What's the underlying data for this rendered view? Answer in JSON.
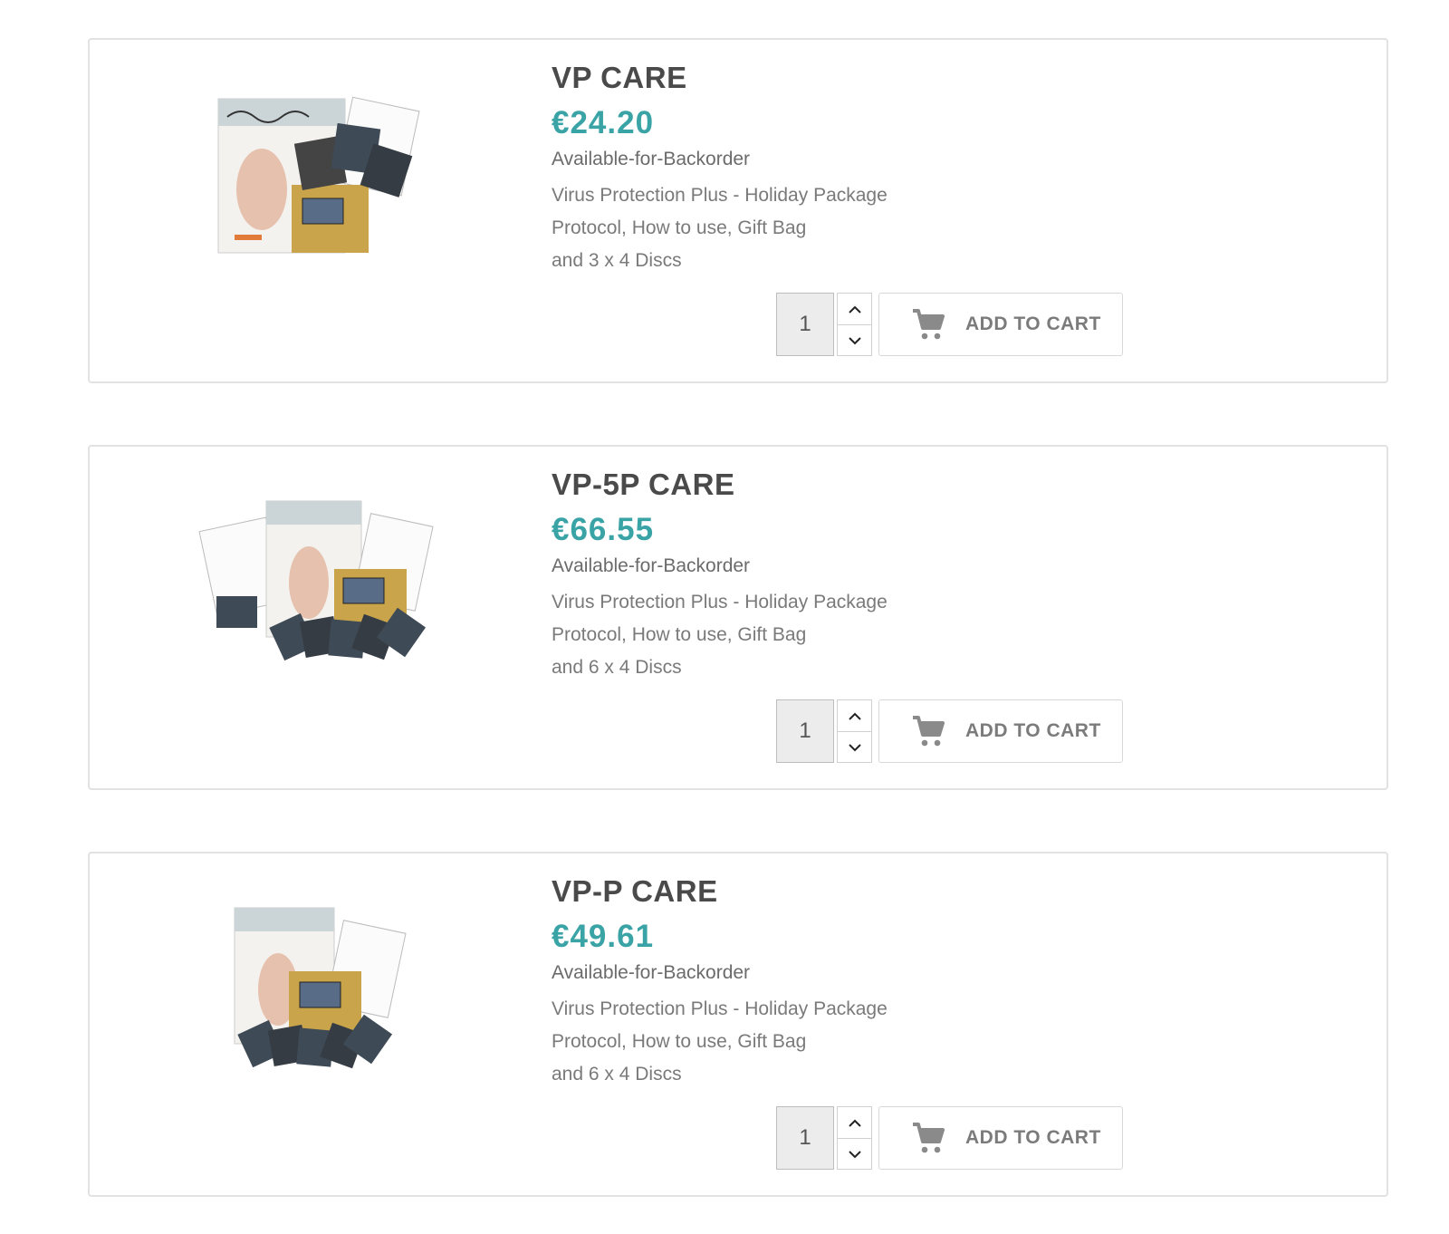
{
  "products": [
    {
      "title": "VP CARE",
      "price": "€24.20",
      "availability": "Available-for-Backorder",
      "description_lines": [
        "Virus Protection Plus - Holiday Package",
        "Protocol, How to use, Gift Bag",
        "and 3 x 4 Discs"
      ],
      "quantity": "1",
      "add_to_cart_label": "ADD TO CART"
    },
    {
      "title": "VP-5P CARE",
      "price": "€66.55",
      "availability": "Available-for-Backorder",
      "description_lines": [
        "Virus Protection Plus - Holiday Package",
        "Protocol, How to use, Gift Bag",
        "and 6 x 4 Discs"
      ],
      "quantity": "1",
      "add_to_cart_label": "ADD TO CART"
    },
    {
      "title": "VP-P CARE",
      "price": "€49.61",
      "availability": "Available-for-Backorder",
      "description_lines": [
        "Virus Protection Plus - Holiday Package",
        "Protocol, How to use, Gift Bag",
        "and 6 x 4 Discs"
      ],
      "quantity": "1",
      "add_to_cart_label": "ADD TO CART"
    }
  ],
  "colors": {
    "price": "#3aa3a6",
    "title": "#4a4a4a",
    "border": "#e2e2e2"
  },
  "icons": {
    "cart": "shopping-cart-icon",
    "up": "chevron-up-icon",
    "down": "chevron-down-icon"
  }
}
